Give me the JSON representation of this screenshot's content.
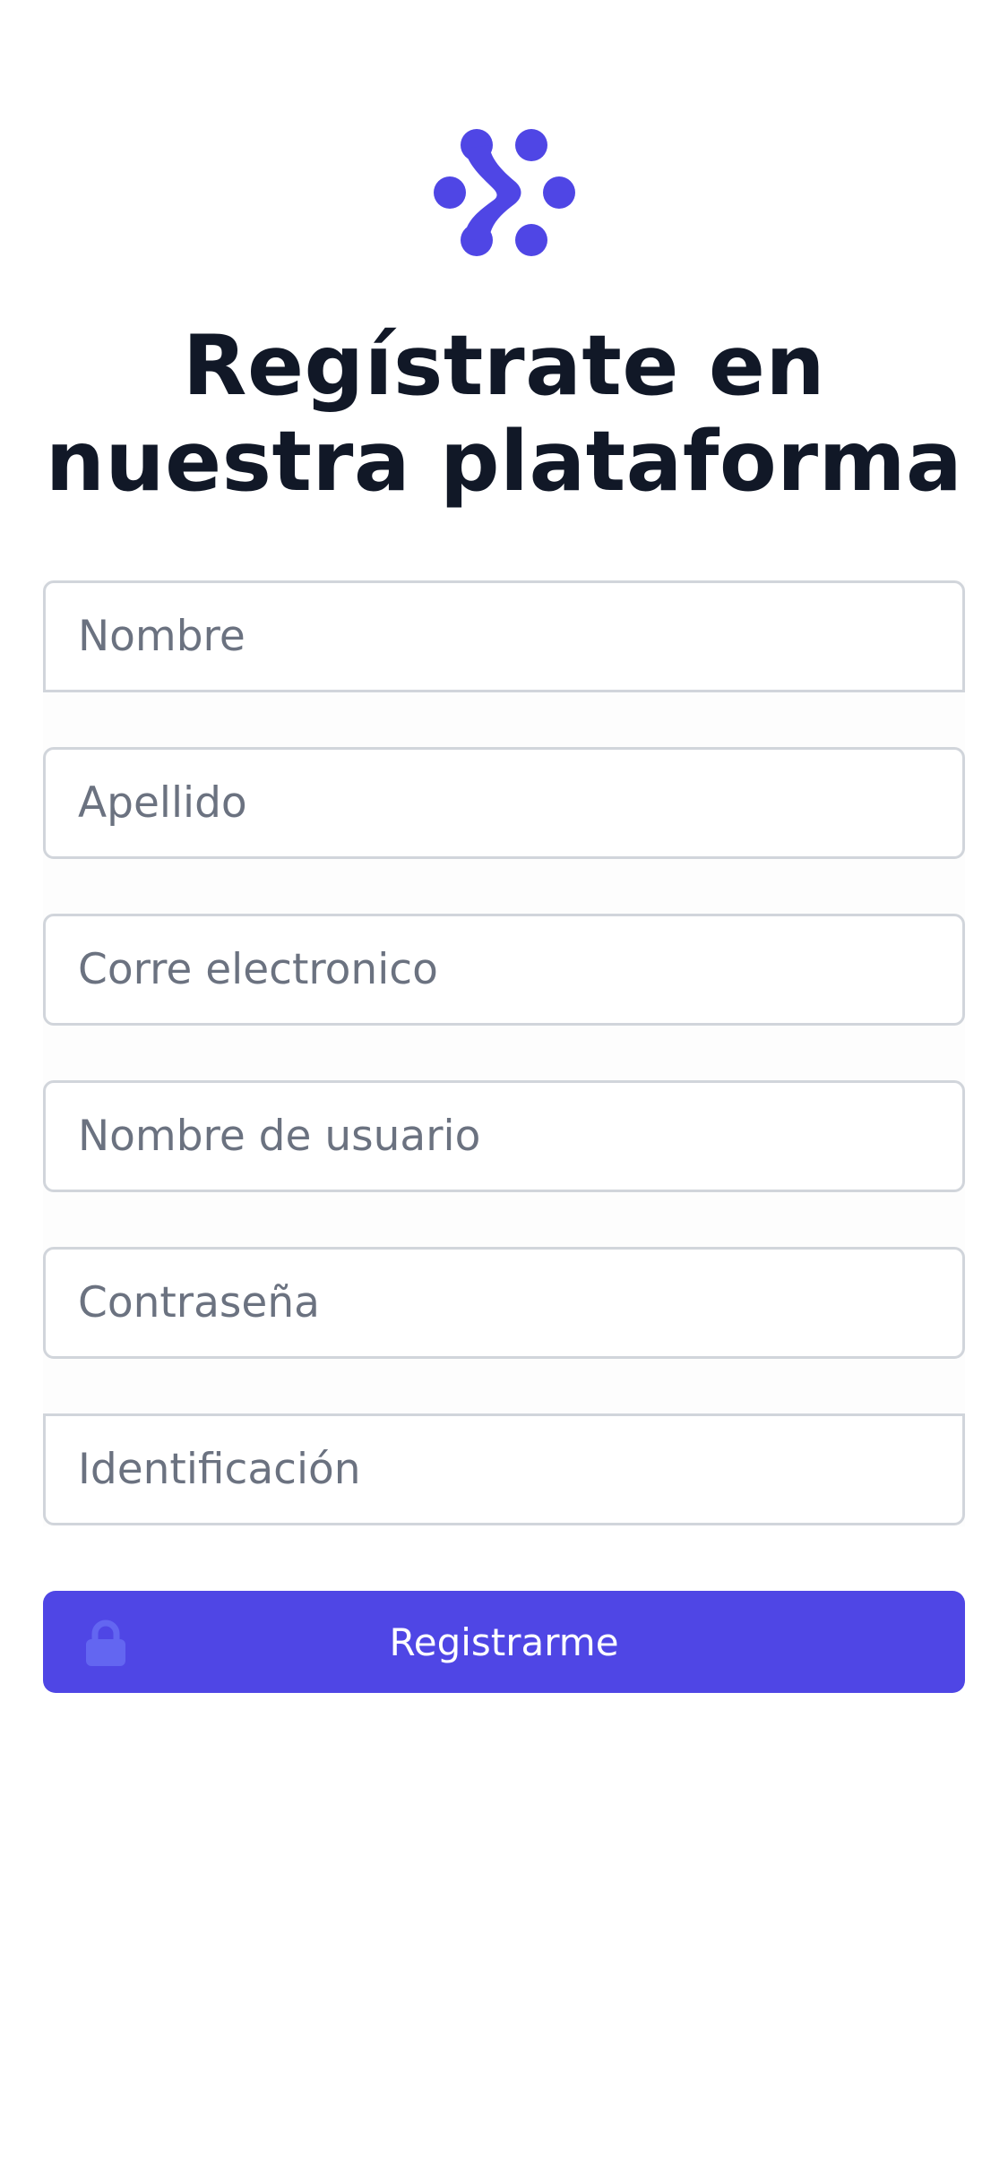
{
  "brand": {
    "logo_icon": "dots-logo-icon",
    "accent_color": "#4f46e5"
  },
  "heading": {
    "title_line1": "Regístrate en",
    "title_line2": "nuestra plataforma"
  },
  "form": {
    "fields": [
      {
        "placeholder": "Nombre",
        "value": ""
      },
      {
        "placeholder": "Apellido",
        "value": ""
      },
      {
        "placeholder": "Corre electronico",
        "value": ""
      },
      {
        "placeholder": "Nombre de usuario",
        "value": ""
      },
      {
        "placeholder": "Contraseña",
        "value": ""
      },
      {
        "placeholder": "Identificación",
        "value": ""
      }
    ],
    "submit_label": "Registrarme",
    "submit_icon": "lock-icon"
  }
}
